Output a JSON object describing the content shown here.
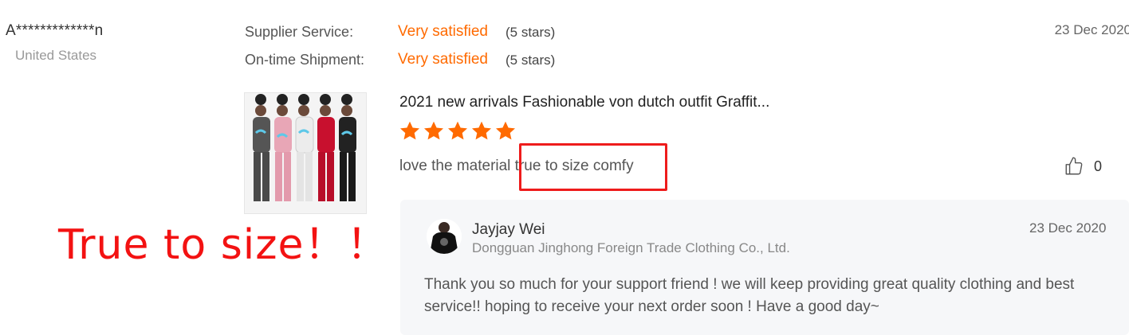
{
  "buyer": {
    "name": "A*************n",
    "country": "United States",
    "date": "23 Dec 2020"
  },
  "ratings": [
    {
      "label": "Supplier Service:",
      "value": "Very satisfied",
      "note": "(5 stars)"
    },
    {
      "label": "On-time Shipment:",
      "value": "Very satisfied",
      "note": "(5 stars)"
    }
  ],
  "product": {
    "title": "2021 new arrivals Fashionable von dutch outfit Graffit...",
    "image_icon": "product-thumbnail-outfits",
    "rating": 5,
    "rating_max": 5
  },
  "review": {
    "text_part1": "love the material",
    "text_part2": " true to size comfy",
    "likes": "0"
  },
  "annotation": {
    "text": "True to size！！",
    "color": "#f31212"
  },
  "reply": {
    "name": "Jayjay Wei",
    "company": "Dongguan Jinghong Foreign Trade Clothing Co., Ltd.",
    "date": "23 Dec 2020",
    "text": "Thank you so much for your support friend !  we will keep providing great quality clothing and best service!! hoping to receive your next order soon ! Have a good day~"
  },
  "colors": {
    "accent": "#ff6a00",
    "highlight": "#ee1c1c",
    "reply_bg": "#f6f7f9"
  }
}
